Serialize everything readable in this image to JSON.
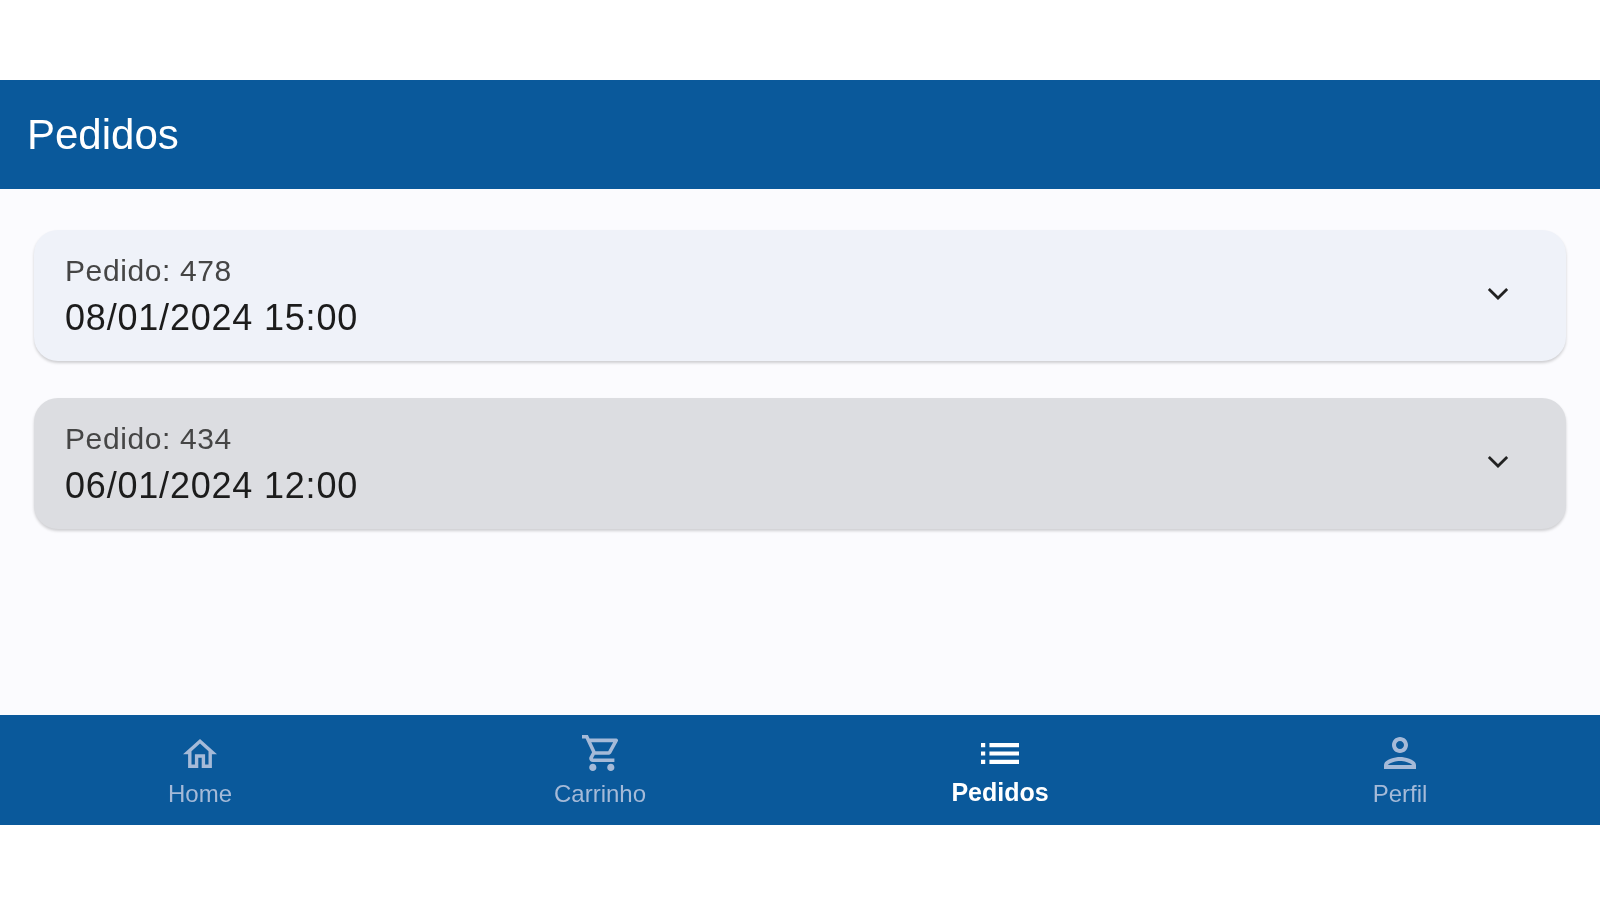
{
  "app_bar": {
    "title": "Pedidos"
  },
  "orders": [
    {
      "label": "Pedido: 478",
      "date": "08/01/2024 15:00",
      "expanded": false,
      "selected": false
    },
    {
      "label": "Pedido: 434",
      "date": "06/01/2024 12:00",
      "expanded": false,
      "selected": true
    }
  ],
  "bottom_nav": [
    {
      "label": "Home",
      "selected": false
    },
    {
      "label": "Carrinho",
      "selected": false
    },
    {
      "label": "Pedidos",
      "selected": true
    },
    {
      "label": "Perfil",
      "selected": false
    }
  ]
}
